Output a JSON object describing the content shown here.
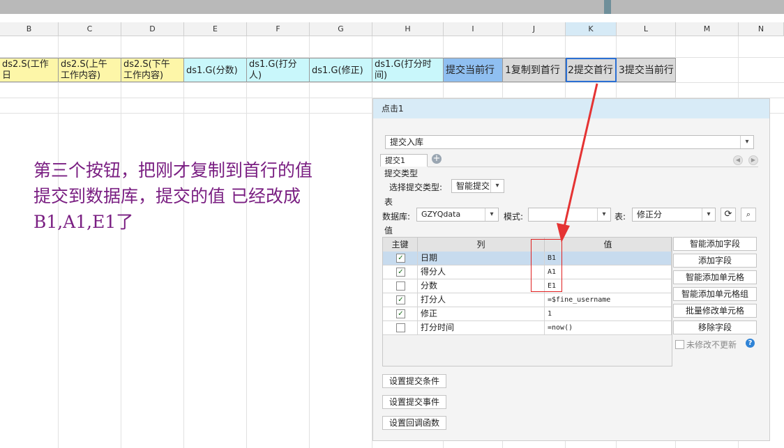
{
  "spreadsheet": {
    "columns": [
      "B",
      "C",
      "D",
      "E",
      "F",
      "G",
      "H",
      "I",
      "J",
      "K",
      "L",
      "M",
      "N"
    ],
    "active_column": "K",
    "cells": [
      {
        "text": "ds2.S(工作日\n)",
        "style": "yellow"
      },
      {
        "text": "ds2.S(上午\n工作内容)",
        "style": "yellow"
      },
      {
        "text": "ds2.S(下午\n工作内容)",
        "style": "yellow"
      },
      {
        "text": "ds1.G(分数)",
        "style": "cyan"
      },
      {
        "text": "ds1.G(打分\n人)",
        "style": "cyan"
      },
      {
        "text": "ds1.G(修正)",
        "style": "cyan"
      },
      {
        "text": "ds1.G(打分时\n间)",
        "style": "cyan"
      },
      {
        "text": "提交当前行",
        "style": "blue"
      },
      {
        "text": "1复制到首行",
        "style": "gray"
      },
      {
        "text": "2提交首行",
        "style": "gray"
      },
      {
        "text": "3提交当前行",
        "style": "gray"
      }
    ]
  },
  "annotation": "第三个按钮，把刚才复制到首行的值\n提交到数据库，提交的值 已经改成\nB1,A1,E1了",
  "dialog": {
    "title": "点击1",
    "action_select": "提交入库",
    "tab_label": "提交1",
    "submit_type_section": "提交类型",
    "submit_type_label": "选择提交类型:",
    "submit_type_value": "智能提交",
    "table_section": "表",
    "db_label": "数据库:",
    "db_value": "GZYQdata",
    "schema_label": "模式:",
    "schema_value": "",
    "table_label": "表:",
    "table_value": "修正分",
    "value_section": "值",
    "grid_headers": {
      "key": "主键",
      "column": "列",
      "value": "值"
    },
    "rows": [
      {
        "checked": true,
        "column": "日期",
        "value": "B1",
        "highlight": true
      },
      {
        "checked": true,
        "column": "得分人",
        "value": "A1",
        "highlight": false
      },
      {
        "checked": false,
        "column": "分数",
        "value": "E1",
        "highlight": false
      },
      {
        "checked": true,
        "column": "打分人",
        "value": "=$fine_username",
        "highlight": false
      },
      {
        "checked": true,
        "column": "修正",
        "value": "1",
        "highlight": false
      },
      {
        "checked": false,
        "column": "打分时间",
        "value": "=now()",
        "highlight": false
      }
    ],
    "side_buttons": [
      "智能添加字段",
      "添加字段",
      "智能添加单元格",
      "智能添加单元格组",
      "批量修改单元格",
      "移除字段"
    ],
    "no_update_label": "未修改不更新",
    "bottom_buttons": [
      "设置提交条件",
      "设置提交事件",
      "设置回调函数"
    ]
  },
  "colors": {
    "annotation": "#7a1f82",
    "arrow": "#e53333",
    "accent": "#2b6fd3"
  }
}
